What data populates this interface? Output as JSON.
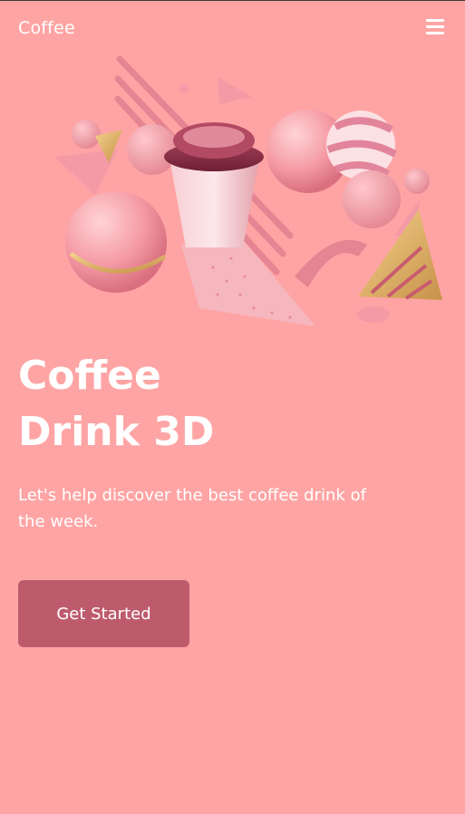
{
  "header": {
    "logo": "Coffee",
    "menu_icon": "hamburger-menu-icon"
  },
  "hero": {
    "title_line1": "Coffee",
    "title_line2": "Drink 3D",
    "subtitle": "Let's help discover the best coffee drink of the week.",
    "cta_label": "Get Started",
    "illustration": "3d-coffee-cup-with-geometric-shapes"
  },
  "colors": {
    "background": "#FFA4A4",
    "button": "#BD5B6D",
    "text": "#FFFFFF"
  }
}
